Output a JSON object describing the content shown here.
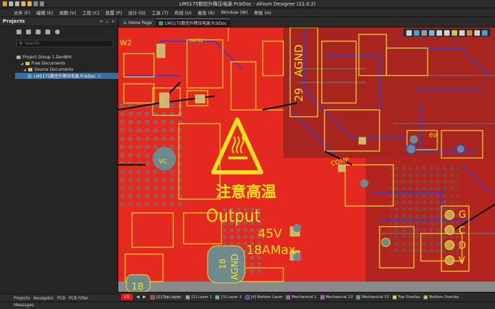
{
  "window": {
    "title": "LM5175数控升降压电源.PcbDoc - Altium Designer (22.0.2)"
  },
  "menu": [
    "文件 (F)",
    "编辑 (E)",
    "视图 (V)",
    "工程 (C)",
    "放置 (P)",
    "设计 (D)",
    "工具 (T)",
    "布线 (U)",
    "报告 (R)",
    "Window (W)",
    "帮助 (H)"
  ],
  "projects_panel": {
    "title": "Projects",
    "search_placeholder": "Search",
    "tree": {
      "group": "Project Group 1.DsnWrk",
      "free_docs": "Free Documents",
      "source_docs": "Source Documents",
      "file": "LM5175数控升降压电源.PcbDoc"
    },
    "bottom_tabs": [
      "Projects",
      "Navigator",
      "PCB",
      "PCB Filter"
    ]
  },
  "doc_tabs": [
    "Home Page",
    "LM5175数控升降压电源.PcbDoc"
  ],
  "pcb": {
    "silk_warning": "注意高温",
    "silk_output": "Output",
    "silk_voltage": "45V",
    "silk_current": "18AMax",
    "silk_agnd": "AGND",
    "silk_agnd2": "AGND",
    "silk_29": "29",
    "silk_18a": "18",
    "silk_18b": "18",
    "silk_vc": "VC",
    "silk_comp": "COMP",
    "silk_6v": "6V",
    "silk_gcdv": [
      "G",
      "C",
      "D",
      "V"
    ],
    "silk_w2": "W2",
    "silk_gate2": "GATE2",
    "colors": {
      "board": "#e52820",
      "silk": "#f2e31d",
      "via": "#6e8a8c",
      "bottom": "#2d3fe6",
      "pad": "#c8b87a"
    }
  },
  "layer_bar": {
    "ls": "LS",
    "layers": [
      {
        "name": "[1] Top Layer",
        "color": "#e52820"
      },
      {
        "name": "[2] Layer 1",
        "color": "#c8a050"
      },
      {
        "name": "[3] Layer 2",
        "color": "#38c8d8"
      },
      {
        "name": "[4] Bottom Layer",
        "color": "#2d3fe6"
      },
      {
        "name": "Mechanical 1",
        "color": "#d040d0"
      },
      {
        "name": "Mechanical 13",
        "color": "#d040d0"
      },
      {
        "name": "Mechanical 15",
        "color": "#3cb44b"
      },
      {
        "name": "Top Overlay",
        "color": "#f2e31d"
      },
      {
        "name": "Bottom Overlay",
        "color": "#e0c020"
      }
    ]
  },
  "status": {
    "messages": "Messages"
  }
}
